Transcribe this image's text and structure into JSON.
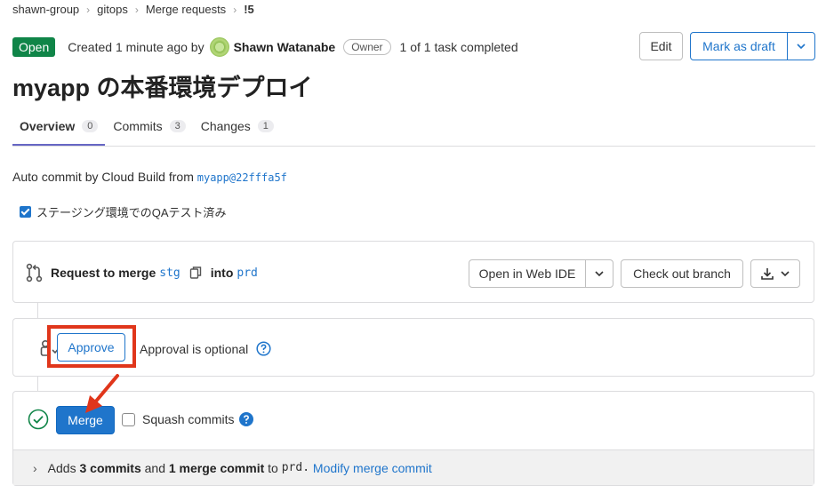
{
  "breadcrumb": {
    "items": [
      "shawn-group",
      "gitops",
      "Merge requests",
      "!5"
    ]
  },
  "header": {
    "status": "Open",
    "created_prefix": "Created 1 minute ago by",
    "author": "Shawn Watanabe",
    "role": "Owner",
    "tasks": "1 of 1 task completed",
    "edit_label": "Edit",
    "draft_label": "Mark as draft"
  },
  "title": "myapp の本番環境デプロイ",
  "tabs": [
    {
      "label": "Overview",
      "count": "0"
    },
    {
      "label": "Commits",
      "count": "3"
    },
    {
      "label": "Changes",
      "count": "1"
    }
  ],
  "description": {
    "text": "Auto commit by Cloud Build from",
    "ref": "myapp@22fffa5f",
    "task": "ステージング環境でのQAテスト済み"
  },
  "merge_widget": {
    "request_label": "Request to merge",
    "source_branch": "stg",
    "into_label": "into",
    "target_branch": "prd",
    "open_ide_label": "Open in Web IDE",
    "checkout_label": "Check out branch"
  },
  "approval": {
    "approve_label": "Approve",
    "optional_text": "Approval is optional"
  },
  "merge": {
    "merge_label": "Merge",
    "squash_label": "Squash commits",
    "footer_prefix": "Adds",
    "commit_count": "3 commits",
    "and_text": "and",
    "merge_commit_count": "1 merge commit",
    "to_text": "to",
    "target": "prd.",
    "modify_link": "Modify merge commit"
  },
  "colors": {
    "open_badge": "#108548",
    "primary": "#1f75cb",
    "highlight": "#e0361b"
  }
}
